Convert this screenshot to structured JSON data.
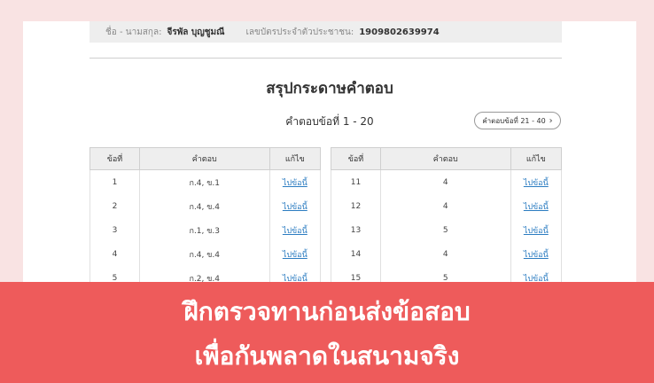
{
  "header": {
    "name_label": "ชื่อ - นามสกุล:",
    "name_value": "จีรพัล บุญชูมณี",
    "id_label": "เลขบัตรประจำตัวประชาชน:",
    "id_value": "1909802639974"
  },
  "title": "สรุปกระดาษคำตอบ",
  "range_label": "คำตอบข้อที่ 1 - 20",
  "next_button": "คำตอบข้อที่ 21 - 40",
  "columns": {
    "no": "ข้อที่",
    "answer": "คำตอบ",
    "fix": "แก้ไข"
  },
  "left_rows": [
    {
      "no": "1",
      "answer": "ก.4, ข.1",
      "link": "ไปข้อนี้"
    },
    {
      "no": "2",
      "answer": "ก.4, ข.4",
      "link": "ไปข้อนี้"
    },
    {
      "no": "3",
      "answer": "ก.1, ข.3",
      "link": "ไปข้อนี้"
    },
    {
      "no": "4",
      "answer": "ก.4, ข.4",
      "link": "ไปข้อนี้"
    },
    {
      "no": "5",
      "answer": "ก.2, ข.4",
      "link": "ไปข้อนี้"
    }
  ],
  "right_rows": [
    {
      "no": "11",
      "answer": "4",
      "link": "ไปข้อนี้"
    },
    {
      "no": "12",
      "answer": "4",
      "link": "ไปข้อนี้"
    },
    {
      "no": "13",
      "answer": "5",
      "link": "ไปข้อนี้"
    },
    {
      "no": "14",
      "answer": "4",
      "link": "ไปข้อนี้"
    },
    {
      "no": "15",
      "answer": "5",
      "link": "ไปข้อนี้"
    }
  ],
  "banner": {
    "line1": "ฝึกตรวจทานก่อนส่งข้อสอบ",
    "line2": "เพื่อกันพลาดในสนามจริง",
    "color": "#ee5b5b"
  }
}
